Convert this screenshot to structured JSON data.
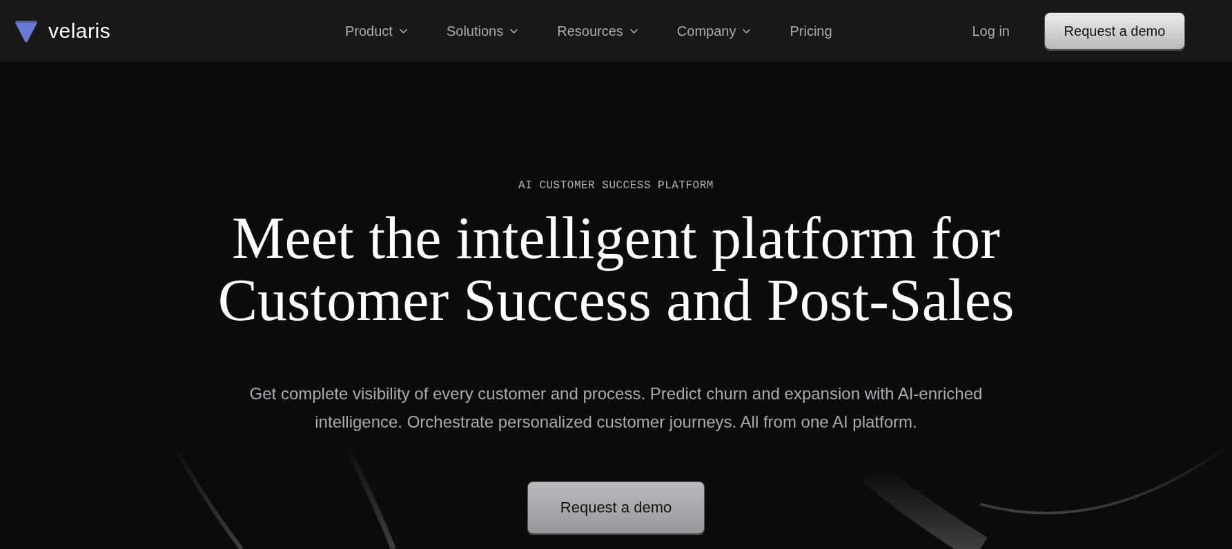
{
  "header": {
    "logo": {
      "wordmark": "velaris"
    },
    "nav": [
      {
        "label": "Product",
        "kind": "dropdown"
      },
      {
        "label": "Solutions",
        "kind": "dropdown"
      },
      {
        "label": "Resources",
        "kind": "dropdown"
      },
      {
        "label": "Company",
        "kind": "dropdown"
      },
      {
        "label": "Pricing",
        "kind": "link"
      }
    ],
    "login": "Log in",
    "cta": "Request a demo"
  },
  "hero": {
    "eyebrow": "AI CUSTOMER SUCCESS PLATFORM",
    "headline": [
      "Meet the intelligent platform for",
      "Customer Success and Post-Sales"
    ],
    "description": "Get complete visibility of every customer and process. Predict churn and expansion with AI-enriched intelligence. Orchestrate personalized customer journeys. All from one AI platform.",
    "cta": "Request a demo"
  }
}
